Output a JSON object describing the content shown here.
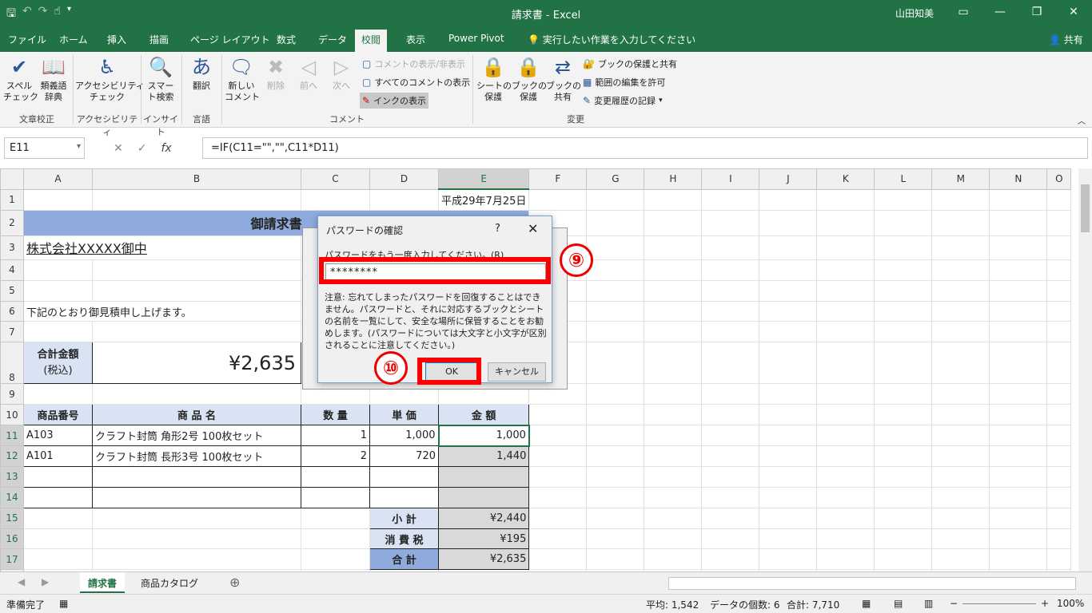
{
  "title_bar": {
    "title": "請求書 - Excel",
    "user": "山田知美"
  },
  "tabs": [
    "ファイル",
    "ホーム",
    "挿入",
    "描画",
    "ページ レイアウト",
    "数式",
    "データ",
    "校閲",
    "表示",
    "Power Pivot"
  ],
  "tell_me": "実行したい作業を入力してください",
  "share": "共有",
  "ribbon": {
    "spell": "スペル\nチェック",
    "thesaurus": "類義語\n辞典",
    "access": "アクセシビリティ\nチェック",
    "smart": "スマー\nト検索",
    "translate": "翻訳",
    "new_comment": "新しい\nコメント",
    "delete": "削除",
    "prev": "前へ",
    "next": "次へ",
    "show_hide": "コメントの表示/非表示",
    "show_all": "すべてのコメントの表示",
    "ink": "インクの表示",
    "protect_sheet": "シートの\n保護",
    "protect_book": "ブックの\n保護",
    "share_book": "ブックの\n共有",
    "protect_share": "ブックの保護と共有",
    "allow_edit": "範囲の編集を許可",
    "track": "変更履歴の記録",
    "groups": {
      "g1": "文章校正",
      "g2": "アクセシビリティ",
      "g3": "インサイト",
      "g4": "言語",
      "g5": "コメント",
      "g6": "変更"
    }
  },
  "formula_bar": {
    "cell": "E11",
    "formula": "=IF(C11=\"\",\"\",C11*D11)"
  },
  "columns": [
    "A",
    "B",
    "C",
    "D",
    "E",
    "F",
    "G",
    "H",
    "I",
    "J",
    "K",
    "L",
    "M",
    "N",
    "O"
  ],
  "cells": {
    "date": "平成29年7月25日",
    "heading": "御請求書",
    "company": "株式会社XXXXX御中",
    "intro": "下記のとおり御見積申し上げます。",
    "total_label": "合計金額",
    "tax_in": "(税込)",
    "total_value": "¥2,635",
    "h_code": "商品番号",
    "h_name": "商 品 名",
    "h_qty": "数 量",
    "h_price": "単 価",
    "h_amount": "金 額",
    "r11": [
      "A103",
      "クラフト封筒 角形2号 100枚セット",
      "1",
      "1,000",
      "1,000"
    ],
    "r12": [
      "A101",
      "クラフト封筒 長形3号 100枚セット",
      "2",
      "720",
      "1,440"
    ],
    "subtotal": "小 計",
    "subtotal_v": "¥2,440",
    "tax": "消 費 税",
    "tax_v": "¥195",
    "grand": "合 計",
    "grand_v": "¥2,635"
  },
  "dialog": {
    "title": "パスワードの確認",
    "help": "?",
    "label": "パスワードをもう一度入力してください。(R)",
    "password": "********",
    "note": "注意: 忘れてしまったパスワードを回復することはできません。パスワードと、それに対応するブックとシートの名前を一覧にして、安全な場所に保管することをお勧めします。(パスワードについては大文字と小文字が区別されることに注意してください。)",
    "ok": "OK",
    "cancel": "キャンセル"
  },
  "markers": {
    "m9": "⑨",
    "m10": "⑩"
  },
  "sheet_tabs": [
    "請求書",
    "商品カタログ"
  ],
  "status": {
    "ready": "準備完了",
    "avg": "平均: 1,542",
    "count": "データの個数: 6",
    "sum": "合計: 7,710",
    "zoom": "100%"
  }
}
